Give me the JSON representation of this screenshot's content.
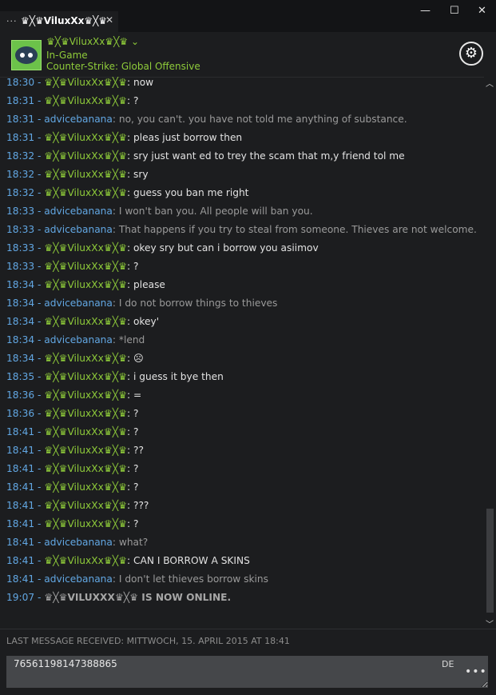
{
  "window": {
    "tab_dots": "...",
    "tab_title": "♛╳♛ViluxXx♛╳♛",
    "tab_close": "✕",
    "minimize": "—",
    "maximize": "☐",
    "close": "✕"
  },
  "header": {
    "name": "♛╳♛ViluxXx♛╳♛ ⌄",
    "status": "In-Game",
    "game": "Counter-Strike: Global Offensive",
    "settings_icon": "⚙"
  },
  "colors": {
    "self_name": "#8fcc3a",
    "friend_name": "#62a7e3",
    "self_text": "#e2e2e2",
    "friend_text": "#9a9a9a",
    "background": "#1c1d1f"
  },
  "messages": [
    {
      "time": "18:30",
      "sep": " - ",
      "sender": "♛╳♛ViluxXx♛╳♛",
      "text": ": now"
    },
    {
      "time": "18:31",
      "sep": " - ",
      "sender": "♛╳♛ViluxXx♛╳♛",
      "text": ": ?"
    },
    {
      "time": "18:31",
      "sep": " - ",
      "sender": "advicebanana",
      "text": ": no, you can't. you have not told me anything of substance."
    },
    {
      "time": "18:31",
      "sep": " - ",
      "sender": "♛╳♛ViluxXx♛╳♛",
      "text": ": pleas just borrow then"
    },
    {
      "time": "18:32",
      "sep": " - ",
      "sender": "♛╳♛ViluxXx♛╳♛",
      "text": ": sry just want ed to trey the scam that m,y friend tol me"
    },
    {
      "time": "18:32",
      "sep": " - ",
      "sender": "♛╳♛ViluxXx♛╳♛",
      "text": ": sry"
    },
    {
      "time": "18:32",
      "sep": " - ",
      "sender": "♛╳♛ViluxXx♛╳♛",
      "text": ": guess you ban me right"
    },
    {
      "time": "18:33",
      "sep": " - ",
      "sender": "advicebanana",
      "text": ": I won't ban you. All people will ban you."
    },
    {
      "time": "18:33",
      "sep": " - ",
      "sender": "advicebanana",
      "text": ": That happens if you try to steal from someone. Thieves are not welcome."
    },
    {
      "time": "18:33",
      "sep": " - ",
      "sender": "♛╳♛ViluxXx♛╳♛",
      "text": ": okey sry but can i borrow you asiimov"
    },
    {
      "time": "18:33",
      "sep": " - ",
      "sender": "♛╳♛ViluxXx♛╳♛",
      "text": ": ?"
    },
    {
      "time": "18:34",
      "sep": " - ",
      "sender": "♛╳♛ViluxXx♛╳♛",
      "text": ": please"
    },
    {
      "time": "18:34",
      "sep": " - ",
      "sender": "advicebanana",
      "text": ": I do not borrow things to thieves"
    },
    {
      "time": "18:34",
      "sep": " - ",
      "sender": "♛╳♛ViluxXx♛╳♛",
      "text": ": okey'"
    },
    {
      "time": "18:34",
      "sep": " - ",
      "sender": "advicebanana",
      "text": ": *lend"
    },
    {
      "time": "18:34",
      "sep": " - ",
      "sender": "♛╳♛ViluxXx♛╳♛",
      "text": ": ☹"
    },
    {
      "time": "18:35",
      "sep": " - ",
      "sender": "♛╳♛ViluxXx♛╳♛",
      "text": ": i guess it bye then"
    },
    {
      "time": "18:36",
      "sep": " - ",
      "sender": "♛╳♛ViluxXx♛╳♛",
      "text": ": ="
    },
    {
      "time": "18:36",
      "sep": " - ",
      "sender": "♛╳♛ViluxXx♛╳♛",
      "text": ": ?"
    },
    {
      "time": "18:41",
      "sep": " - ",
      "sender": "♛╳♛ViluxXx♛╳♛",
      "text": ": ?"
    },
    {
      "time": "18:41",
      "sep": " - ",
      "sender": "♛╳♛ViluxXx♛╳♛",
      "text": ": ??"
    },
    {
      "time": "18:41",
      "sep": " - ",
      "sender": "♛╳♛ViluxXx♛╳♛",
      "text": ": ?"
    },
    {
      "time": "18:41",
      "sep": " - ",
      "sender": "♛╳♛ViluxXx♛╳♛",
      "text": ": ?"
    },
    {
      "time": "18:41",
      "sep": " - ",
      "sender": "♛╳♛ViluxXx♛╳♛",
      "text": ": ???"
    },
    {
      "time": "18:41",
      "sep": " - ",
      "sender": "♛╳♛ViluxXx♛╳♛",
      "text": ": ?"
    },
    {
      "time": "18:41",
      "sep": " - ",
      "sender": "advicebanana",
      "text": ": what?"
    },
    {
      "time": "18:41",
      "sep": " - ",
      "sender": "♛╳♛ViluxXx♛╳♛",
      "text": ": CAN I BORROW A SKINS"
    },
    {
      "time": "18:41",
      "sep": " - ",
      "sender": "advicebanana",
      "text": ": I don't let thieves borrow skins"
    }
  ],
  "system_message": {
    "time": "19:07",
    "sep": " - ",
    "text": "♛╳♛VILUXXX♛╳♛ IS NOW ONLINE."
  },
  "last_message": "LAST MESSAGE RECEIVED: MITTWOCH, 15. APRIL 2015 AT 18:41",
  "input": {
    "value": "76561198147388865",
    "language": "DE",
    "more": "•••"
  },
  "scroll": {
    "up": "︿",
    "down": "﹀"
  }
}
